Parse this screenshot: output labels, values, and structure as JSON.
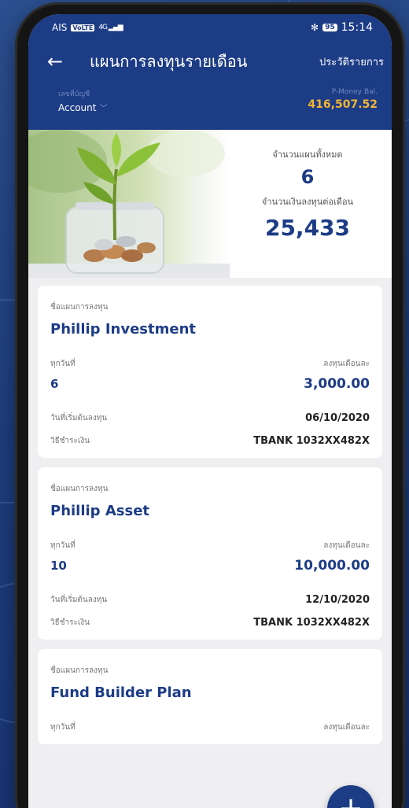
{
  "status_bar": {
    "carrier": "AIS",
    "volte": "VoLTE",
    "signal": "4G",
    "battery": "95",
    "time": "15:14"
  },
  "header": {
    "title": "แผนการลงทุนรายเดือน",
    "history_link": "ประวัติรายการ",
    "account_label": "เลขที่บัญชี",
    "account_value": "Account",
    "pmoney_label": "P-Money Bal.",
    "pmoney_value": "416,507.52"
  },
  "summary": {
    "plans_label": "จำนวนแผนทั้งหมด",
    "plans_count": "6",
    "monthly_label": "จำนวนเงินลงทุนต่อเดือน",
    "monthly_amount": "25,433"
  },
  "labels": {
    "plan_name": "ชื่อแผนการลงทุน",
    "every_day": "ทุกวันที่",
    "monthly": "ลงทุนเดือนละ",
    "start_date": "วันที่เริ่มต้นลงทุน",
    "payment": "วิธีชำระเงิน"
  },
  "plans": [
    {
      "name": "Phillip Investment",
      "day": "6",
      "amount": "3,000.00",
      "start": "06/10/2020",
      "payment": "TBANK 1032XX482X"
    },
    {
      "name": "Phillip Asset",
      "day": "10",
      "amount": "10,000.00",
      "start": "12/10/2020",
      "payment": "TBANK 1032XX482X"
    },
    {
      "name": "Fund Builder Plan"
    }
  ],
  "fab": {
    "label": "+"
  },
  "colors": {
    "brand": "#1d3c86",
    "accent": "#f2b632"
  }
}
